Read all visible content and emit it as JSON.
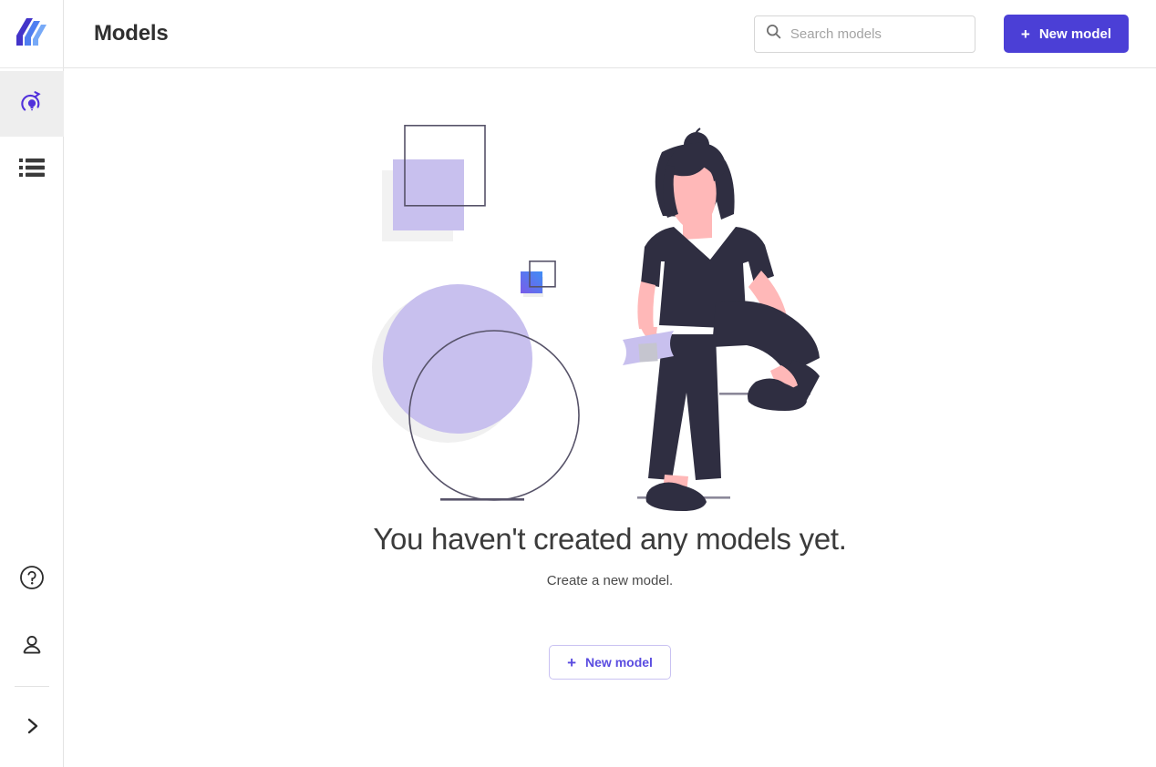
{
  "app": {
    "logo_icon": "layers-logo-icon"
  },
  "sidebar": {
    "items": [
      {
        "icon": "model-lightbulb-refresh-icon",
        "name": "models",
        "active": true
      },
      {
        "icon": "list-datasets-icon",
        "name": "datasets",
        "active": false
      }
    ],
    "bottom_items": [
      {
        "icon": "help-circle-icon",
        "name": "help"
      },
      {
        "icon": "user-account-icon",
        "name": "account"
      },
      {
        "icon": "chevron-right-icon",
        "name": "expand-sidebar"
      }
    ]
  },
  "header": {
    "title": "Models",
    "search": {
      "placeholder": "Search models",
      "value": "",
      "icon": "search-icon"
    },
    "new_model_button": {
      "label": "New model",
      "icon": "plus-icon"
    }
  },
  "empty_state": {
    "title": "You haven't created any models yet.",
    "subtitle": "Create a new model.",
    "button": {
      "label": "New model",
      "icon": "plus-icon"
    },
    "illustration_name": "person-with-shapes-illustration"
  },
  "colors": {
    "primary": "#4b3fd6",
    "primary_soft": "#5a4ce0",
    "outline_border": "#c9c2f2",
    "shape_purple": "#c8c0ee",
    "shape_gray": "#f0f0f0",
    "shape_outline": "#4e4b66",
    "figure_dark": "#2f2e41",
    "figure_skin": "#ffb8b8",
    "sidebar_active": "#eeeeee"
  }
}
